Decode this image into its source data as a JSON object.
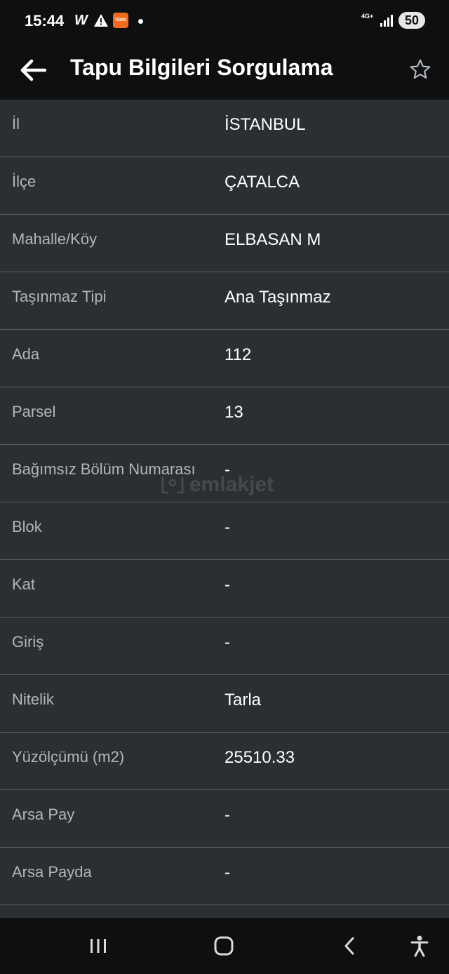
{
  "status_bar": {
    "time": "15:44",
    "app_letter": "W",
    "temu_label": "TEMU",
    "network": "4G+",
    "battery": "50"
  },
  "app_bar": {
    "title": "Tapu Bilgileri Sorgulama"
  },
  "fields": [
    {
      "label": "İl",
      "value": "İSTANBUL"
    },
    {
      "label": "İlçe",
      "value": "ÇATALCA"
    },
    {
      "label": "Mahalle/Köy",
      "value": "ELBASAN M"
    },
    {
      "label": "Taşınmaz Tipi",
      "value": "Ana Taşınmaz"
    },
    {
      "label": "Ada",
      "value": "112"
    },
    {
      "label": "Parsel",
      "value": "13"
    },
    {
      "label": "Bağımsız Bölüm Numarası",
      "value": "-"
    },
    {
      "label": "Blok",
      "value": "-"
    },
    {
      "label": "Kat",
      "value": "-"
    },
    {
      "label": "Giriş",
      "value": "-"
    },
    {
      "label": "Nitelik",
      "value": "Tarla"
    },
    {
      "label": "Yüzölçümü (m2)",
      "value": "25510.33"
    },
    {
      "label": "Arsa Pay",
      "value": "-"
    },
    {
      "label": "Arsa Payda",
      "value": "-"
    },
    {
      "label": "",
      "value": ""
    }
  ],
  "watermark": {
    "text": "emlakjet"
  },
  "colors": {
    "background": "#2a2f34",
    "bar": "#0e0f10",
    "divider": "#5a5f63",
    "label": "#b3b6b9",
    "value": "#ffffff"
  }
}
